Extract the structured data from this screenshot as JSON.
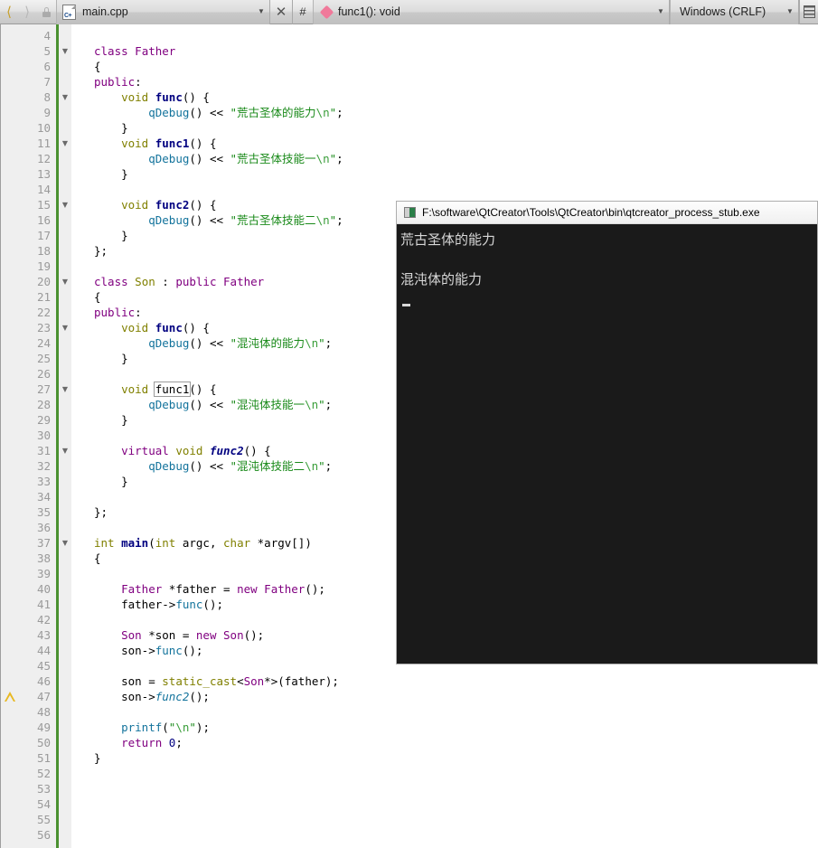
{
  "toolbar": {
    "back_icon": "chevron-left-icon",
    "forward_icon": "chevron-right-icon",
    "lock_icon": "lock-icon",
    "file_name": "main.cpp",
    "file_icon": "cpp-file-icon",
    "close_label": "✕",
    "hash_label": "#",
    "symbol_icon": "method-diamond-icon",
    "symbol_name": "func1(): void",
    "encoding": "Windows (CRLF)",
    "dropdown_arrow": "▼",
    "split_icon": "text-wrap-icon"
  },
  "editor": {
    "first_line": 4,
    "last_line": 56,
    "warning_line": 47,
    "warning_icon": "warning-triangle-icon",
    "fold_icon": "chevron-down-icon",
    "fold_lines": [
      5,
      8,
      11,
      15,
      20,
      23,
      27,
      31,
      37
    ],
    "lines": [
      {
        "n": 4,
        "tokens": []
      },
      {
        "n": 5,
        "tokens": [
          [
            "kwp",
            "class"
          ],
          [
            "pnc",
            " "
          ],
          [
            "typ",
            "Father"
          ]
        ]
      },
      {
        "n": 6,
        "tokens": [
          [
            "pnc",
            "{"
          ]
        ]
      },
      {
        "n": 7,
        "tokens": [
          [
            "kwp",
            "public"
          ],
          [
            "pnc",
            ":"
          ]
        ]
      },
      {
        "n": 8,
        "tokens": [
          [
            "pnc",
            "    "
          ],
          [
            "kw",
            "void"
          ],
          [
            "pnc",
            " "
          ],
          [
            "fn",
            "func"
          ],
          [
            "pnc",
            "() {"
          ]
        ]
      },
      {
        "n": 9,
        "tokens": [
          [
            "pnc",
            "        "
          ],
          [
            "call",
            "qDebug"
          ],
          [
            "pnc",
            "() << "
          ],
          [
            "str",
            "\"荒古圣体的能力"
          ],
          [
            "esc",
            "\\n"
          ],
          [
            "str",
            "\""
          ],
          [
            "pnc",
            ";"
          ]
        ]
      },
      {
        "n": 10,
        "tokens": [
          [
            "pnc",
            "    }"
          ]
        ]
      },
      {
        "n": 11,
        "tokens": [
          [
            "pnc",
            "    "
          ],
          [
            "kw",
            "void"
          ],
          [
            "pnc",
            " "
          ],
          [
            "fn",
            "func1"
          ],
          [
            "pnc",
            "() {"
          ]
        ]
      },
      {
        "n": 12,
        "tokens": [
          [
            "pnc",
            "        "
          ],
          [
            "call",
            "qDebug"
          ],
          [
            "pnc",
            "() << "
          ],
          [
            "str",
            "\"荒古圣体技能一"
          ],
          [
            "esc",
            "\\n"
          ],
          [
            "str",
            "\""
          ],
          [
            "pnc",
            ";"
          ]
        ]
      },
      {
        "n": 13,
        "tokens": [
          [
            "pnc",
            "    }"
          ]
        ]
      },
      {
        "n": 14,
        "tokens": []
      },
      {
        "n": 15,
        "tokens": [
          [
            "pnc",
            "    "
          ],
          [
            "kw",
            "void"
          ],
          [
            "pnc",
            " "
          ],
          [
            "fn",
            "func2"
          ],
          [
            "pnc",
            "() {"
          ]
        ]
      },
      {
        "n": 16,
        "tokens": [
          [
            "pnc",
            "        "
          ],
          [
            "call",
            "qDebug"
          ],
          [
            "pnc",
            "() << "
          ],
          [
            "str",
            "\"荒古圣体技能二"
          ],
          [
            "esc",
            "\\n"
          ],
          [
            "str",
            "\""
          ],
          [
            "pnc",
            ";"
          ]
        ]
      },
      {
        "n": 17,
        "tokens": [
          [
            "pnc",
            "    }"
          ]
        ]
      },
      {
        "n": 18,
        "tokens": [
          [
            "pnc",
            "};"
          ]
        ]
      },
      {
        "n": 19,
        "tokens": []
      },
      {
        "n": 20,
        "tokens": [
          [
            "kwp",
            "class"
          ],
          [
            "pnc",
            " "
          ],
          [
            "kw",
            "Son"
          ],
          [
            "pnc",
            " : "
          ],
          [
            "kwp",
            "public"
          ],
          [
            "pnc",
            " "
          ],
          [
            "typ",
            "Father"
          ]
        ]
      },
      {
        "n": 21,
        "tokens": [
          [
            "pnc",
            "{"
          ]
        ]
      },
      {
        "n": 22,
        "tokens": [
          [
            "kwp",
            "public"
          ],
          [
            "pnc",
            ":"
          ]
        ]
      },
      {
        "n": 23,
        "tokens": [
          [
            "pnc",
            "    "
          ],
          [
            "kw",
            "void"
          ],
          [
            "pnc",
            " "
          ],
          [
            "fn",
            "func"
          ],
          [
            "pnc",
            "() {"
          ]
        ]
      },
      {
        "n": 24,
        "tokens": [
          [
            "pnc",
            "        "
          ],
          [
            "call",
            "qDebug"
          ],
          [
            "pnc",
            "() << "
          ],
          [
            "str",
            "\"混沌体的能力"
          ],
          [
            "esc",
            "\\n"
          ],
          [
            "str",
            "\""
          ],
          [
            "pnc",
            ";"
          ]
        ]
      },
      {
        "n": 25,
        "tokens": [
          [
            "pnc",
            "    }"
          ]
        ]
      },
      {
        "n": 26,
        "tokens": []
      },
      {
        "n": 27,
        "tokens": [
          [
            "pnc",
            "    "
          ],
          [
            "kw",
            "void"
          ],
          [
            "pnc",
            " "
          ],
          [
            "occ",
            "func1"
          ],
          [
            "pnc",
            "() {"
          ]
        ]
      },
      {
        "n": 28,
        "tokens": [
          [
            "pnc",
            "        "
          ],
          [
            "call",
            "qDebug"
          ],
          [
            "pnc",
            "() << "
          ],
          [
            "str",
            "\"混沌体技能一"
          ],
          [
            "esc",
            "\\n"
          ],
          [
            "str",
            "\""
          ],
          [
            "pnc",
            ";"
          ]
        ]
      },
      {
        "n": 29,
        "tokens": [
          [
            "pnc",
            "    }"
          ]
        ]
      },
      {
        "n": 30,
        "tokens": []
      },
      {
        "n": 31,
        "tokens": [
          [
            "pnc",
            "    "
          ],
          [
            "kwp",
            "virtual"
          ],
          [
            "pnc",
            " "
          ],
          [
            "kw",
            "void"
          ],
          [
            "pnc",
            " "
          ],
          [
            "fnv",
            "func2"
          ],
          [
            "pnc",
            "() {"
          ]
        ]
      },
      {
        "n": 32,
        "tokens": [
          [
            "pnc",
            "        "
          ],
          [
            "call",
            "qDebug"
          ],
          [
            "pnc",
            "() << "
          ],
          [
            "str",
            "\"混沌体技能二"
          ],
          [
            "esc",
            "\\n"
          ],
          [
            "str",
            "\""
          ],
          [
            "pnc",
            ";"
          ]
        ]
      },
      {
        "n": 33,
        "tokens": [
          [
            "pnc",
            "    }"
          ]
        ]
      },
      {
        "n": 34,
        "tokens": []
      },
      {
        "n": 35,
        "tokens": [
          [
            "pnc",
            "};"
          ]
        ]
      },
      {
        "n": 36,
        "tokens": []
      },
      {
        "n": 37,
        "tokens": [
          [
            "kw",
            "int"
          ],
          [
            "pnc",
            " "
          ],
          [
            "fn",
            "main"
          ],
          [
            "pnc",
            "("
          ],
          [
            "kw",
            "int"
          ],
          [
            "pnc",
            " argc, "
          ],
          [
            "kw",
            "char"
          ],
          [
            "pnc",
            " *argv[])"
          ]
        ]
      },
      {
        "n": 38,
        "tokens": [
          [
            "pnc",
            "{"
          ]
        ]
      },
      {
        "n": 39,
        "tokens": []
      },
      {
        "n": 40,
        "tokens": [
          [
            "pnc",
            "    "
          ],
          [
            "typ",
            "Father"
          ],
          [
            "pnc",
            " *father = "
          ],
          [
            "kwp",
            "new"
          ],
          [
            "pnc",
            " "
          ],
          [
            "typ",
            "Father"
          ],
          [
            "pnc",
            "();"
          ]
        ]
      },
      {
        "n": 41,
        "tokens": [
          [
            "pnc",
            "    father->"
          ],
          [
            "call",
            "func"
          ],
          [
            "pnc",
            "();"
          ]
        ]
      },
      {
        "n": 42,
        "tokens": []
      },
      {
        "n": 43,
        "tokens": [
          [
            "pnc",
            "    "
          ],
          [
            "typ",
            "Son"
          ],
          [
            "pnc",
            " *son = "
          ],
          [
            "kwp",
            "new"
          ],
          [
            "pnc",
            " "
          ],
          [
            "typ",
            "Son"
          ],
          [
            "pnc",
            "();"
          ]
        ]
      },
      {
        "n": 44,
        "tokens": [
          [
            "pnc",
            "    son->"
          ],
          [
            "call",
            "func"
          ],
          [
            "pnc",
            "();"
          ]
        ]
      },
      {
        "n": 45,
        "tokens": []
      },
      {
        "n": 46,
        "tokens": [
          [
            "pnc",
            "    son = "
          ],
          [
            "kw",
            "static_cast"
          ],
          [
            "pnc",
            "<"
          ],
          [
            "typ",
            "Son"
          ],
          [
            "pnc",
            "*>(father);"
          ]
        ]
      },
      {
        "n": 47,
        "tokens": [
          [
            "pnc",
            "    son->"
          ],
          [
            "calli",
            "func2"
          ],
          [
            "pnc",
            "();"
          ]
        ]
      },
      {
        "n": 48,
        "tokens": []
      },
      {
        "n": 49,
        "tokens": [
          [
            "pnc",
            "    "
          ],
          [
            "call",
            "printf"
          ],
          [
            "pnc",
            "("
          ],
          [
            "str",
            "\""
          ],
          [
            "esc",
            "\\n"
          ],
          [
            "str",
            "\""
          ],
          [
            "pnc",
            ");"
          ]
        ]
      },
      {
        "n": 50,
        "tokens": [
          [
            "pnc",
            "    "
          ],
          [
            "kwp",
            "return"
          ],
          [
            "pnc",
            " "
          ],
          [
            "num",
            "0"
          ],
          [
            "pnc",
            ";"
          ]
        ]
      },
      {
        "n": 51,
        "tokens": [
          [
            "pnc",
            "}"
          ]
        ]
      },
      {
        "n": 52,
        "tokens": []
      },
      {
        "n": 53,
        "tokens": []
      },
      {
        "n": 54,
        "tokens": []
      },
      {
        "n": 55,
        "tokens": []
      },
      {
        "n": 56,
        "tokens": []
      }
    ]
  },
  "console": {
    "icon": "console-app-icon",
    "title": "F:\\software\\QtCreator\\Tools\\QtCreator\\bin\\qtcreator_process_stub.exe",
    "output_lines": [
      "荒古圣体的能力",
      "",
      "混沌体的能力"
    ],
    "cursor": "block-cursor"
  },
  "colors": {
    "keyword": "#808000",
    "preproc_keyword": "#800080",
    "type": "#800080",
    "function": "#000080",
    "call": "#13739c",
    "string": "#1a8a1a",
    "changebar": "#4a9130",
    "warning": "#e8b820",
    "console_bg": "#1a1a1a",
    "symbol_accent": "#f0799a"
  }
}
